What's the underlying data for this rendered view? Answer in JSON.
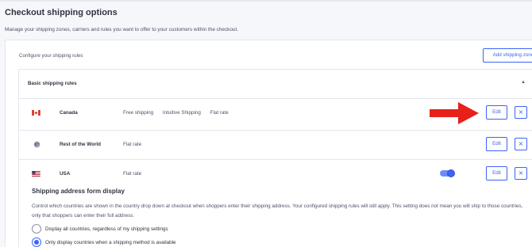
{
  "page": {
    "title": "Checkout shipping options",
    "description": "Manage your shipping zones, carriers and rules you want to offer to your customers within the checkout."
  },
  "card": {
    "heading": "Configure your shipping rules",
    "add_zone_label": "Add shipping zone"
  },
  "rules": {
    "title": "Basic shipping rules",
    "collapse_icon": "caret-up-icon",
    "zones": [
      {
        "country": "Canada",
        "icon": "canada-flag-icon",
        "methods": [
          "Free shipping",
          "Intuitive Shipping",
          "Flat rate"
        ],
        "edit_label": "Edit",
        "delete_label": "×",
        "toggle": false
      },
      {
        "country": "Rest of the World",
        "icon": "globe-icon",
        "methods": [
          "Flat rate"
        ],
        "edit_label": "Edit",
        "delete_label": "×",
        "toggle": false
      },
      {
        "country": "USA",
        "icon": "usa-flag-icon",
        "methods": [
          "Flat rate"
        ],
        "edit_label": "Edit",
        "delete_label": "×",
        "toggle": true
      }
    ]
  },
  "address_display": {
    "title": "Shipping address form display",
    "description": "Control which countries are shown in the country drop down at checkout when shoppers enter their shipping address. Your configured shipping rules will still apply. This setting does not mean you will ship to those countries, only that shoppers can enter their full address.",
    "options": [
      {
        "label": "Display all countries, regardless of my shipping settings",
        "checked": false
      },
      {
        "label": "Only display countries when a shipping method is available",
        "checked": true
      }
    ]
  },
  "colors": {
    "accent": "#3c64f4",
    "annotation_arrow": "#e8201a"
  }
}
